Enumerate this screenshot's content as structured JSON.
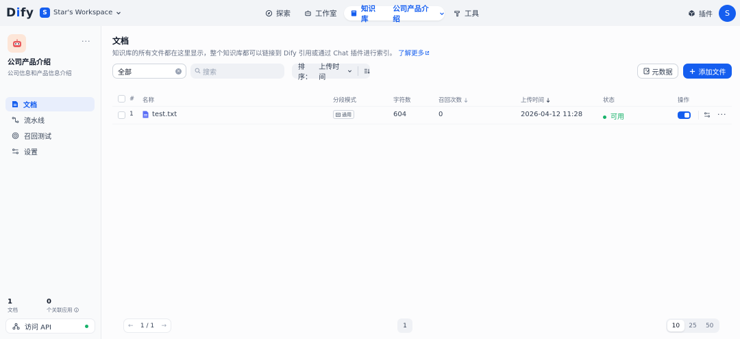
{
  "app": {
    "logo_text": "Dify",
    "logo_accent": "i"
  },
  "workspace": {
    "badge": "S",
    "name": "Star's Workspace"
  },
  "nav": {
    "explore": "探索",
    "studio": "工作室",
    "knowledge": "知识库",
    "current_kb": "公司产品介绍",
    "tools": "工具",
    "plugins": "插件",
    "avatar": "S"
  },
  "sidebar": {
    "kb_name": "公司产品介绍",
    "kb_desc": "公司信息和产品信息介绍",
    "items": [
      {
        "label": "文档",
        "icon": "document-icon",
        "active": true
      },
      {
        "label": "流水线",
        "icon": "pipeline-icon",
        "active": false
      },
      {
        "label": "召回测试",
        "icon": "target-icon",
        "active": false
      },
      {
        "label": "设置",
        "icon": "settings-icon",
        "active": false
      }
    ],
    "stats": [
      {
        "value": "1",
        "label": "文档"
      },
      {
        "value": "0",
        "label": "个关联应用"
      }
    ],
    "api_button": "访问 API"
  },
  "header": {
    "title": "文档",
    "description": "知识库的所有文件都在这里显示，整个知识库都可以链接到 Dify 引用或通过 Chat 插件进行索引。",
    "learn_more": "了解更多"
  },
  "toolbar": {
    "filter_value": "全部",
    "search_placeholder": "搜索",
    "sort_prefix": "排序：",
    "sort_value": "上传时间",
    "metadata_button": "元数据",
    "add_button": "添加文件"
  },
  "table": {
    "headers": {
      "index": "#",
      "name": "名称",
      "chunk_mode": "分段模式",
      "chars": "字符数",
      "hits": "召回次数",
      "uploaded": "上传时间",
      "status": "状态",
      "actions": "操作"
    },
    "rows": [
      {
        "index": "1",
        "name": "test.txt",
        "chunk_mode": "通用",
        "chars": "604",
        "hits": "0",
        "uploaded": "2026-04-12 11:28",
        "status": "可用",
        "enabled": true
      }
    ]
  },
  "pagination": {
    "page_info": "1 / 1",
    "current": "1",
    "sizes": [
      "10",
      "25",
      "50"
    ],
    "selected_size": "10"
  },
  "colors": {
    "accent": "#155eef",
    "success": "#17b26a"
  }
}
